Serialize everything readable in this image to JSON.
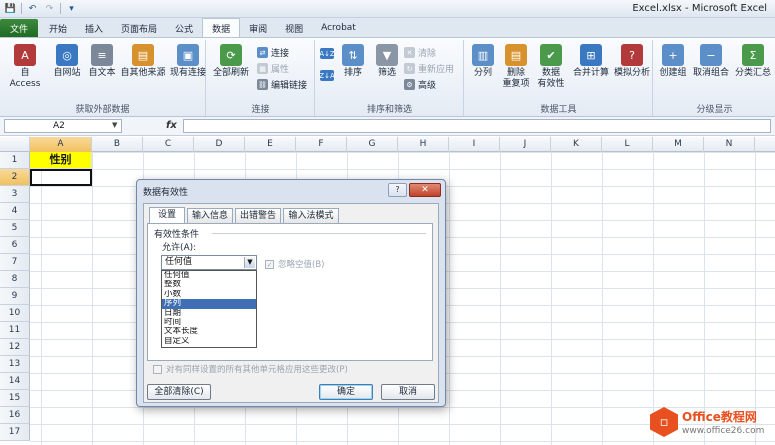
{
  "window": {
    "title": "Excel.xlsx - Microsoft Excel"
  },
  "qat": {
    "save": "💾",
    "undo": "↶",
    "redo": "↷",
    "customize": "▾"
  },
  "tabs": [
    {
      "label": "文件"
    },
    {
      "label": "开始"
    },
    {
      "label": "插入"
    },
    {
      "label": "页面布局"
    },
    {
      "label": "公式"
    },
    {
      "label": "数据"
    },
    {
      "label": "审阅"
    },
    {
      "label": "视图"
    },
    {
      "label": "Acrobat"
    }
  ],
  "ribbon": {
    "groups": {
      "external": "获取外部数据",
      "connections": "连接",
      "sort_filter": "排序和筛选",
      "data_tools": "数据工具",
      "outline": "分级显示"
    },
    "buttons": {
      "access": "自 Access",
      "web": "自网站",
      "text": "自文本",
      "other": "自其他来源",
      "existing": "现有连接",
      "refresh": "全部刷新",
      "connections": "连接",
      "properties": "属性",
      "edit_links": "编辑链接",
      "sort_az": "A↓Z",
      "sort_za": "Z↓A",
      "sort": "排序",
      "filter": "筛选",
      "clear": "清除",
      "reapply": "重新应用",
      "advanced": "高级",
      "split": "分列",
      "remove_dup_1": "删除",
      "remove_dup_2": "重复项",
      "validation_1": "数据",
      "validation_2": "有效性",
      "consolidate": "合并计算",
      "whatif": "模拟分析",
      "group": "创建组",
      "ungroup": "取消组合",
      "subtotal": "分类汇总"
    }
  },
  "formula_bar": {
    "cell_ref": "A2",
    "fx": "fx",
    "content": ""
  },
  "grid": {
    "columns": [
      "A",
      "B",
      "C",
      "D",
      "E",
      "F",
      "G",
      "H",
      "I",
      "J",
      "K",
      "L",
      "M",
      "N",
      "O"
    ],
    "rows": [
      "1",
      "2",
      "3",
      "4",
      "5",
      "6",
      "7",
      "8",
      "9",
      "10",
      "11",
      "12",
      "13",
      "14",
      "15",
      "16",
      "17"
    ],
    "a1_value": "性别"
  },
  "dialog": {
    "title": "数据有效性",
    "help": "?",
    "close": "✕",
    "tabs": [
      "设置",
      "输入信息",
      "出错警告",
      "输入法模式"
    ],
    "section_title": "有效性条件",
    "allow_label": "允许(A):",
    "allow_value": "任何值",
    "options": [
      "任何值",
      "整数",
      "小数",
      "序列",
      "日期",
      "时间",
      "文本长度",
      "自定义"
    ],
    "selected_option": "序列",
    "ignore_blank": "忽略空值(B)",
    "apply_all": "对有同样设置的所有其他单元格应用这些更改(P)",
    "clear_all": "全部清除(C)",
    "ok": "确定",
    "cancel": "取消"
  },
  "watermark": {
    "name": "Office教程网",
    "url": "www.office26.com"
  }
}
